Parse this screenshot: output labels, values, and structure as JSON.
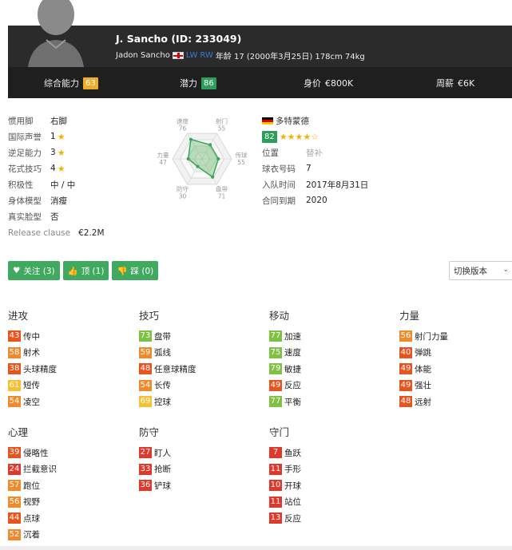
{
  "player": {
    "name_id": "J. Sancho (ID: 233049)",
    "full_name": "Jadon Sancho",
    "positions": [
      "LW",
      "RW"
    ],
    "bio": "年龄 17 (2000年3月25日) 178cm 74kg"
  },
  "stats": [
    {
      "label": "综合能力",
      "value": "63",
      "color": "#f0ad28"
    },
    {
      "label": "潜力",
      "value": "86",
      "color": "#2d9e5a"
    },
    {
      "label": "身价",
      "value": "€800K"
    },
    {
      "label": "周薪",
      "value": "€6K"
    }
  ],
  "info": [
    {
      "key": "惯用脚",
      "value": "右脚"
    },
    {
      "key": "国际声誉",
      "value": "1",
      "star": "★"
    },
    {
      "key": "逆足能力",
      "value": "3",
      "star": "★"
    },
    {
      "key": "花式技巧",
      "value": "4",
      "star": "★"
    },
    {
      "key": "积极性",
      "value": "中 / 中"
    },
    {
      "key": "身体模型",
      "value": "消瘦"
    },
    {
      "key": "真实脸型",
      "value": "否"
    }
  ],
  "release": {
    "key": "Release clause",
    "value": "€2.2M"
  },
  "radar": {
    "labels": [
      {
        "name": "速度",
        "value": "76"
      },
      {
        "name": "射门",
        "value": "55"
      },
      {
        "name": "传球",
        "value": "55"
      },
      {
        "name": "盘带",
        "value": "71"
      },
      {
        "name": "防守",
        "value": "30"
      },
      {
        "name": "力量",
        "value": "47"
      }
    ],
    "values": [
      76,
      55,
      55,
      71,
      30,
      47
    ],
    "max": 100
  },
  "club": {
    "name": "多特蒙德",
    "rating": "82",
    "stars": "★★★★☆",
    "rows": [
      {
        "key": "位置",
        "value": "替补",
        "muted": true
      },
      {
        "key": "球衣号码",
        "value": "7"
      },
      {
        "key": "入队时间",
        "value": "2017年8月31日"
      },
      {
        "key": "合同到期",
        "value": "2020"
      }
    ]
  },
  "buttons": {
    "follow": "关注 (3)",
    "like": "顶 (1)",
    "dislike": "踩 (0)",
    "version": "切换版本"
  },
  "groups": [
    {
      "title": "进攻",
      "items": [
        {
          "v": "43",
          "c": "#e8541e",
          "n": "传中"
        },
        {
          "v": "58",
          "c": "#f08a2a",
          "n": "射术"
        },
        {
          "v": "38",
          "c": "#e8541e",
          "n": "头球精度"
        },
        {
          "v": "61",
          "c": "#f5c132",
          "n": "短传"
        },
        {
          "v": "54",
          "c": "#f08a2a",
          "n": "凌空"
        }
      ]
    },
    {
      "title": "技巧",
      "items": [
        {
          "v": "73",
          "c": "#7fc243",
          "n": "盘带"
        },
        {
          "v": "59",
          "c": "#f08a2a",
          "n": "弧线"
        },
        {
          "v": "48",
          "c": "#e8541e",
          "n": "任意球精度"
        },
        {
          "v": "54",
          "c": "#f08a2a",
          "n": "长传"
        },
        {
          "v": "69",
          "c": "#f5c132",
          "n": "控球"
        }
      ]
    },
    {
      "title": "移动",
      "items": [
        {
          "v": "77",
          "c": "#7fc243",
          "n": "加速"
        },
        {
          "v": "75",
          "c": "#7fc243",
          "n": "速度"
        },
        {
          "v": "79",
          "c": "#7fc243",
          "n": "敏捷"
        },
        {
          "v": "49",
          "c": "#e8541e",
          "n": "反应"
        },
        {
          "v": "77",
          "c": "#7fc243",
          "n": "平衡"
        }
      ]
    },
    {
      "title": "力量",
      "items": [
        {
          "v": "56",
          "c": "#f08a2a",
          "n": "射门力量"
        },
        {
          "v": "40",
          "c": "#e8541e",
          "n": "弹跳"
        },
        {
          "v": "49",
          "c": "#e8541e",
          "n": "体能"
        },
        {
          "v": "49",
          "c": "#e8541e",
          "n": "强壮"
        },
        {
          "v": "48",
          "c": "#e8541e",
          "n": "远射"
        }
      ]
    },
    {
      "title": "心理",
      "items": [
        {
          "v": "39",
          "c": "#e8541e",
          "n": "侵略性"
        },
        {
          "v": "24",
          "c": "#e0392b",
          "n": "拦截意识"
        },
        {
          "v": "57",
          "c": "#f08a2a",
          "n": "跑位"
        },
        {
          "v": "56",
          "c": "#f08a2a",
          "n": "视野"
        },
        {
          "v": "44",
          "c": "#e8541e",
          "n": "点球"
        },
        {
          "v": "52",
          "c": "#f08a2a",
          "n": "沉着"
        }
      ]
    },
    {
      "title": "防守",
      "items": [
        {
          "v": "27",
          "c": "#e0392b",
          "n": "盯人"
        },
        {
          "v": "33",
          "c": "#e0392b",
          "n": "抢断"
        },
        {
          "v": "36",
          "c": "#e0392b",
          "n": "铲球"
        }
      ]
    },
    {
      "title": "守门",
      "items": [
        {
          "v": "7",
          "c": "#e0392b",
          "n": "鱼跃"
        },
        {
          "v": "11",
          "c": "#e0392b",
          "n": "手形"
        },
        {
          "v": "10",
          "c": "#e0392b",
          "n": "开球"
        },
        {
          "v": "11",
          "c": "#e0392b",
          "n": "站位"
        },
        {
          "v": "13",
          "c": "#e0392b",
          "n": "反应"
        }
      ]
    }
  ]
}
